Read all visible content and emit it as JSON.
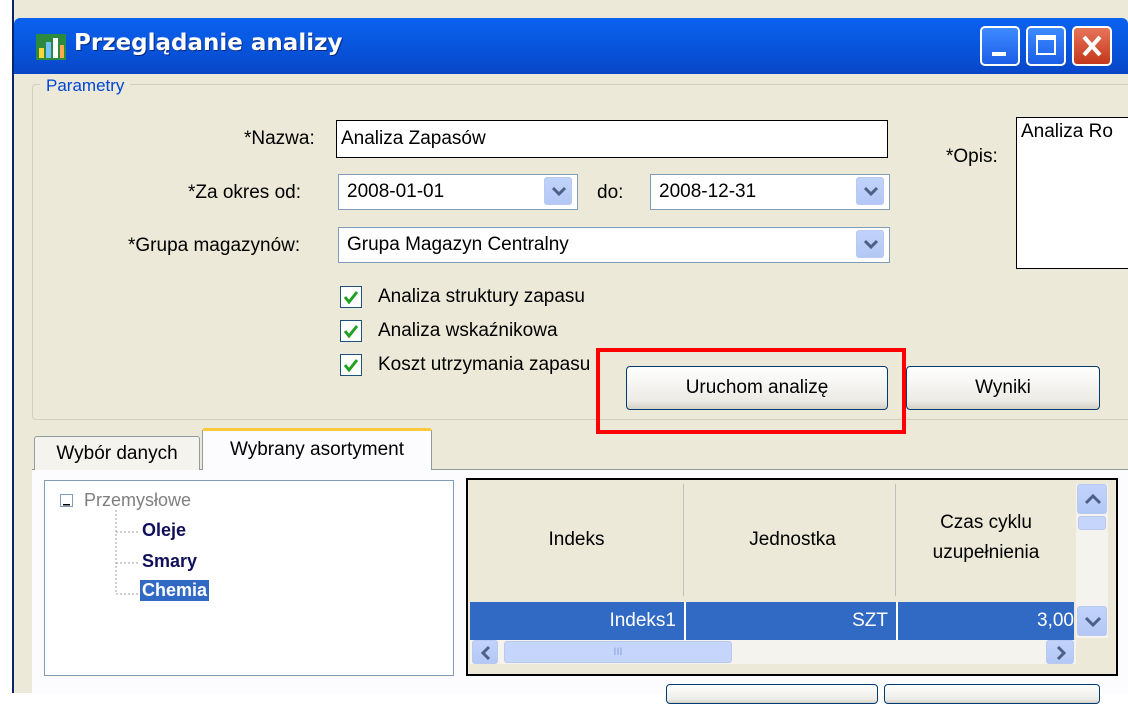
{
  "window": {
    "title": "Przeglądanie analizy",
    "title_icon": "chart-icon",
    "controls": [
      "minimize-icon",
      "maximize-icon",
      "close-icon"
    ]
  },
  "parameters": {
    "group_label": "Parametry",
    "name_label": "*Nazwa:",
    "name_value": "Analiza Zapasów",
    "desc_label": "*Opis:",
    "desc_value": "Analiza Ro",
    "period_from_label": "*Za okres od:",
    "period_from_value": "2008-01-01",
    "period_to_label": "do:",
    "period_to_value": "2008-12-31",
    "warehouse_group_label": "*Grupa magazynów:",
    "warehouse_group_value": "Grupa Magazyn Centralny",
    "checkboxes": [
      {
        "label": "Analiza struktury zapasu",
        "checked": true
      },
      {
        "label": "Analiza wskaźnikowa",
        "checked": true
      },
      {
        "label": "Koszt utrzymania zapasu",
        "checked": true
      }
    ],
    "run_button": "Uruchom analizę",
    "results_button": "Wyniki"
  },
  "tabs": {
    "items": [
      "Wybór danych",
      "Wybrany asortyment"
    ],
    "active": 1
  },
  "tree": {
    "root": "Przemysłowe",
    "children": [
      "Oleje",
      "Smary",
      "Chemia"
    ],
    "selected": "Chemia"
  },
  "grid": {
    "columns": [
      "Indeks",
      "Jednostka",
      "Czas cyklu uzupełnienia"
    ],
    "rows": [
      {
        "index": "Indeks1",
        "unit": "SZT",
        "cycle": "3,00"
      }
    ],
    "hscroll_glyph": "III"
  },
  "colors": {
    "titlebar": "#0855dd",
    "highlight": "#ff0000",
    "selection": "#316ac5",
    "tree_text": "#10105a"
  }
}
